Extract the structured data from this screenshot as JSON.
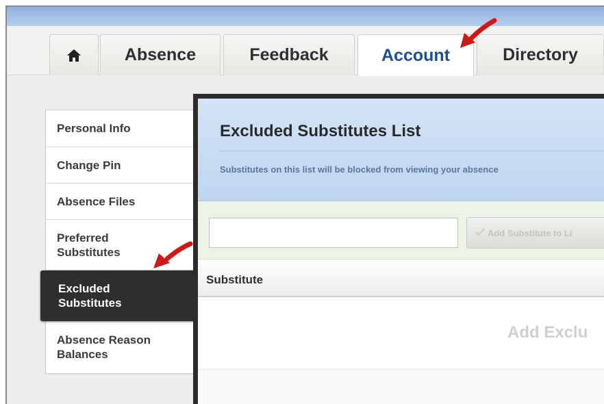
{
  "nav": {
    "home_icon": "home-icon",
    "tabs": [
      {
        "label": "Absence"
      },
      {
        "label": "Feedback"
      },
      {
        "label": "Account",
        "active": true
      },
      {
        "label": "Directory"
      }
    ]
  },
  "sidebar": {
    "items": [
      {
        "label": "Personal Info"
      },
      {
        "label": "Change Pin"
      },
      {
        "label": "Absence Files"
      },
      {
        "label": "Preferred Substitutes"
      },
      {
        "label": "Excluded Substitutes",
        "active": true
      },
      {
        "label": "Absence Reason Balances"
      }
    ]
  },
  "panel": {
    "title": "Excluded Substitutes List",
    "subtitle": "Substitutes on this list will be blocked from viewing your absence",
    "search_value": "",
    "add_button_label": "Add Substitute to Li",
    "column_header": "Substitute",
    "empty_text": "Add Exclu"
  },
  "colors": {
    "active_tab_text": "#1f4f8c",
    "active_sidebar_bg": "#2e2e2e",
    "header_bg": "#c9ddf4",
    "toolbar_bg": "#eaf3e6",
    "annotation_arrow": "#cc1a1a"
  }
}
